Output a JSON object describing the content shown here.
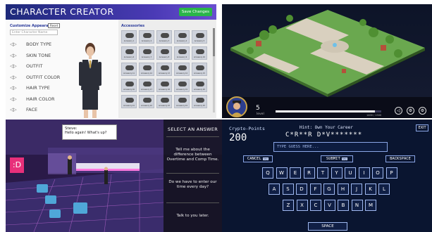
{
  "character_creator": {
    "title": "CHARACTER CREATOR",
    "save_label": "Save Changes",
    "section_label": "Customize Appearance",
    "reset_label": "Reset",
    "name_placeholder": "Enter Character Name",
    "options": [
      "BODY TYPE",
      "SKIN TONE",
      "OUTFIT",
      "OUTFIT COLOR",
      "HAIR TYPE",
      "HAIR COLOR",
      "FACE"
    ],
    "accessories_label": "Accessories",
    "accessories": [
      "Accessory 1",
      "Accessory 2",
      "Accessory 3",
      "Accessory 4",
      "Accessory 5",
      "Accessory 6",
      "Accessory 7",
      "Accessory 8",
      "Accessory 9",
      "Accessory 10",
      "Accessory 11",
      "Accessory 12",
      "Accessory 13",
      "Accessory 14",
      "Accessory 15",
      "Accessory 16",
      "Accessory 17",
      "Accessory 18",
      "Accessory 19",
      "Accessory 20",
      "Accessory 21",
      "Accessory 22",
      "Accessory 23",
      "Accessory 24",
      "Accessory 25"
    ]
  },
  "city_map": {
    "level_value": "5",
    "level_label": "level",
    "xp_progress": 0.94,
    "xp_text": "1400 / 1500",
    "controls": [
      "◁",
      "⚙",
      "⚙"
    ]
  },
  "dialogue": {
    "speaker": "Steve:",
    "message": "Hello again! What's up?",
    "sign_text": ":D",
    "answers_title": "SELECT AN ANSWER",
    "answers": [
      "Tell me about the difference between Overtime and Comp Time.",
      "Do we have to enter our time every day?",
      "Talk to you later."
    ]
  },
  "crypto_game": {
    "points_label": "Crypto-Points",
    "points_value": "200",
    "hint": "Hint: Own Your Career",
    "puzzle": "C*R**R D*V*******",
    "exit_label": "EXIT",
    "guess_placeholder": "TYPE GUESS HERE...",
    "cancel_label": "CANCEL",
    "submit_label": "SUBMIT",
    "backspace_label": "BACKSPACE",
    "key_badge": "key",
    "space_label": "SPACE",
    "keyboard_rows": [
      [
        "Q",
        "W",
        "E",
        "R",
        "T",
        "Y",
        "U",
        "I",
        "O",
        "P"
      ],
      [
        "A",
        "S",
        "D",
        "F",
        "G",
        "H",
        "J",
        "K",
        "L"
      ],
      [
        "Z",
        "X",
        "C",
        "V",
        "B",
        "N",
        "M"
      ]
    ]
  },
  "colors": {
    "creator_header": "#3a2fa6",
    "save_green": "#2ab54a",
    "keyboard_border": "#9fb8f0",
    "sign_pink": "#e8307a"
  }
}
